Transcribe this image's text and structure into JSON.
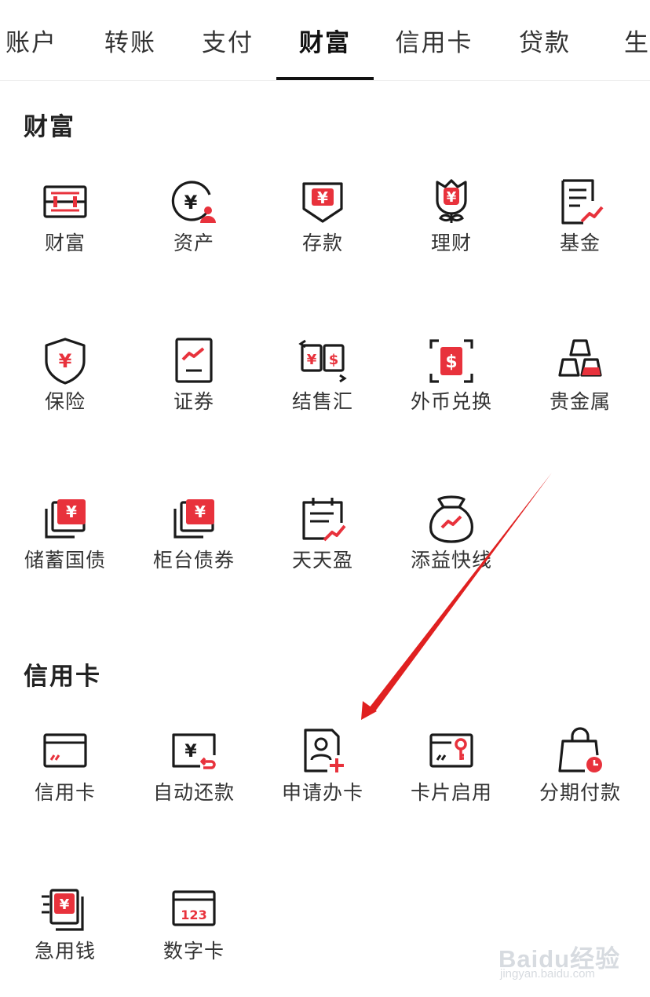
{
  "tabs": [
    {
      "label": "账户"
    },
    {
      "label": "转账"
    },
    {
      "label": "支付"
    },
    {
      "label": "财富",
      "active": true
    },
    {
      "label": "信用卡"
    },
    {
      "label": "贷款"
    },
    {
      "label": "生活"
    }
  ],
  "wealth": {
    "title": "财富",
    "items": [
      {
        "label": "财富",
        "icon": "wealth-box-icon"
      },
      {
        "label": "资产",
        "icon": "assets-yuan-icon"
      },
      {
        "label": "存款",
        "icon": "deposit-icon"
      },
      {
        "label": "理财",
        "icon": "finance-flower-icon"
      },
      {
        "label": "基金",
        "icon": "fund-document-icon"
      },
      {
        "label": "保险",
        "icon": "insurance-shield-icon"
      },
      {
        "label": "证券",
        "icon": "securities-chart-icon"
      },
      {
        "label": "结售汇",
        "icon": "exchange-settlement-icon"
      },
      {
        "label": "外币兑换",
        "icon": "foreign-currency-icon"
      },
      {
        "label": "贵金属",
        "icon": "gold-bars-icon"
      },
      {
        "label": "储蓄国债",
        "icon": "savings-bond-icon"
      },
      {
        "label": "柜台债券",
        "icon": "counter-bond-icon"
      },
      {
        "label": "天天盈",
        "icon": "daily-profit-icon"
      },
      {
        "label": "添益快线",
        "icon": "money-bag-icon"
      }
    ]
  },
  "credit": {
    "title": "信用卡",
    "items": [
      {
        "label": "信用卡",
        "icon": "credit-card-icon"
      },
      {
        "label": "自动还款",
        "icon": "auto-repay-icon"
      },
      {
        "label": "申请办卡",
        "icon": "apply-card-icon"
      },
      {
        "label": "卡片启用",
        "icon": "card-activate-icon"
      },
      {
        "label": "分期付款",
        "icon": "installment-bag-icon"
      },
      {
        "label": "急用钱",
        "icon": "urgent-cash-icon"
      },
      {
        "label": "数字卡",
        "icon": "digital-card-icon",
        "badge": "123"
      }
    ]
  },
  "watermark": {
    "main": "Baidu经验",
    "sub": "jingyan.baidu.com"
  },
  "colors": {
    "accent": "#e8323c",
    "text": "#222222",
    "stroke": "#1a1a1a"
  }
}
